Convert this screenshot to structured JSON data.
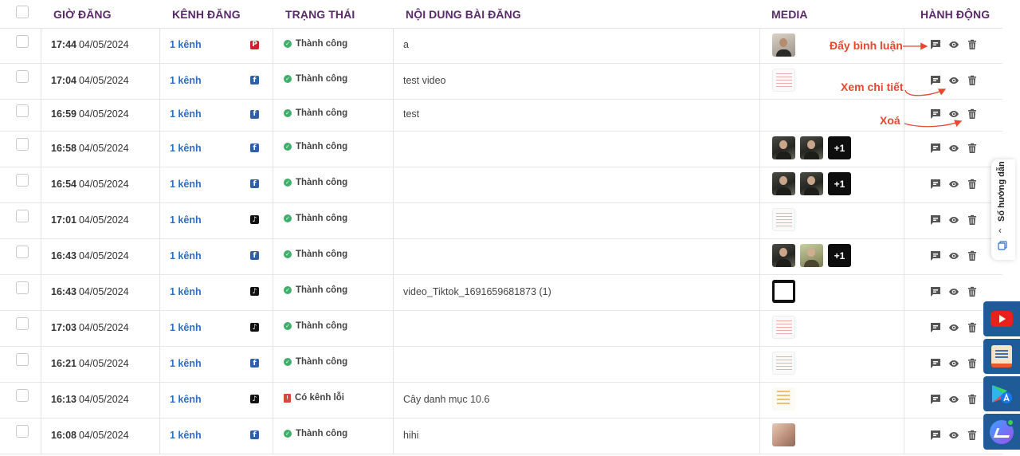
{
  "headers": {
    "time": "GIỜ ĐĂNG",
    "channel": "KÊNH ĐĂNG",
    "status": "TRẠNG THÁI",
    "content": "NỘI DUNG BÀI ĐĂNG",
    "media": "MEDIA",
    "actions": "HÀNH ĐỘNG"
  },
  "rows": [
    {
      "time": "17:44",
      "date": "04/05/2024",
      "channel": "1 kênh",
      "platform": "pinterest",
      "status": "Thành công",
      "status_type": "success",
      "content": "a",
      "media": [
        "light"
      ],
      "more": ""
    },
    {
      "time": "17:04",
      "date": "04/05/2024",
      "channel": "1 kênh",
      "platform": "facebook",
      "status": "Thành công",
      "status_type": "success",
      "content": "test video",
      "media": [
        "doc"
      ],
      "more": ""
    },
    {
      "time": "16:59",
      "date": "04/05/2024",
      "channel": "1 kênh",
      "platform": "facebook",
      "status": "Thành công",
      "status_type": "success",
      "content": "test",
      "media": [],
      "more": ""
    },
    {
      "time": "16:58",
      "date": "04/05/2024",
      "channel": "1 kênh",
      "platform": "facebook",
      "status": "Thành công",
      "status_type": "success",
      "content": "",
      "media": [
        "person",
        "person"
      ],
      "more": "+1"
    },
    {
      "time": "16:54",
      "date": "04/05/2024",
      "channel": "1 kênh",
      "platform": "facebook",
      "status": "Thành công",
      "status_type": "success",
      "content": "",
      "media": [
        "person",
        "person"
      ],
      "more": "+1"
    },
    {
      "time": "17:01",
      "date": "04/05/2024",
      "channel": "1 kênh",
      "platform": "tiktok",
      "status": "Thành công",
      "status_type": "success",
      "content": "",
      "media": [
        "doc"
      ],
      "more": ""
    },
    {
      "time": "16:43",
      "date": "04/05/2024",
      "channel": "1 kênh",
      "platform": "facebook",
      "status": "Thành công",
      "status_type": "success",
      "content": "",
      "media": [
        "person",
        "green"
      ],
      "more": "+1"
    },
    {
      "time": "16:43",
      "date": "04/05/2024",
      "channel": "1 kênh",
      "platform": "tiktok",
      "status": "Thành công",
      "status_type": "success",
      "content": "video_Tiktok_1691659681873 (1)",
      "media": [
        "video"
      ],
      "more": ""
    },
    {
      "time": "17:03",
      "date": "04/05/2024",
      "channel": "1 kênh",
      "platform": "tiktok",
      "status": "Thành công",
      "status_type": "success",
      "content": "",
      "media": [
        "doc"
      ],
      "more": ""
    },
    {
      "time": "16:21",
      "date": "04/05/2024",
      "channel": "1 kênh",
      "platform": "facebook",
      "status": "Thành công",
      "status_type": "success",
      "content": "",
      "media": [
        "doc"
      ],
      "more": ""
    },
    {
      "time": "16:13",
      "date": "04/05/2024",
      "channel": "1 kênh",
      "platform": "tiktok",
      "status": "Có kênh lỗi",
      "status_type": "error",
      "content": "Cây danh mục 10.6",
      "media": [
        "map"
      ],
      "more": ""
    },
    {
      "time": "16:08",
      "date": "04/05/2024",
      "channel": "1 kênh",
      "platform": "facebook",
      "status": "Thành công",
      "status_type": "success",
      "content": "hihi",
      "media": [
        "skin"
      ],
      "more": ""
    }
  ],
  "annotations": {
    "comment": "Đẩy bình luận",
    "view": "Xem chi tiết",
    "delete": "Xoá"
  },
  "guide": {
    "label": "Sổ hướng dẫn"
  },
  "colors": {
    "header_text": "#5a2a6a",
    "channel_link": "#2d6fc3",
    "success": "#3fae6a",
    "error": "#d9463a",
    "annotation": "#e8472f",
    "float_bg": "#1f5c97"
  }
}
